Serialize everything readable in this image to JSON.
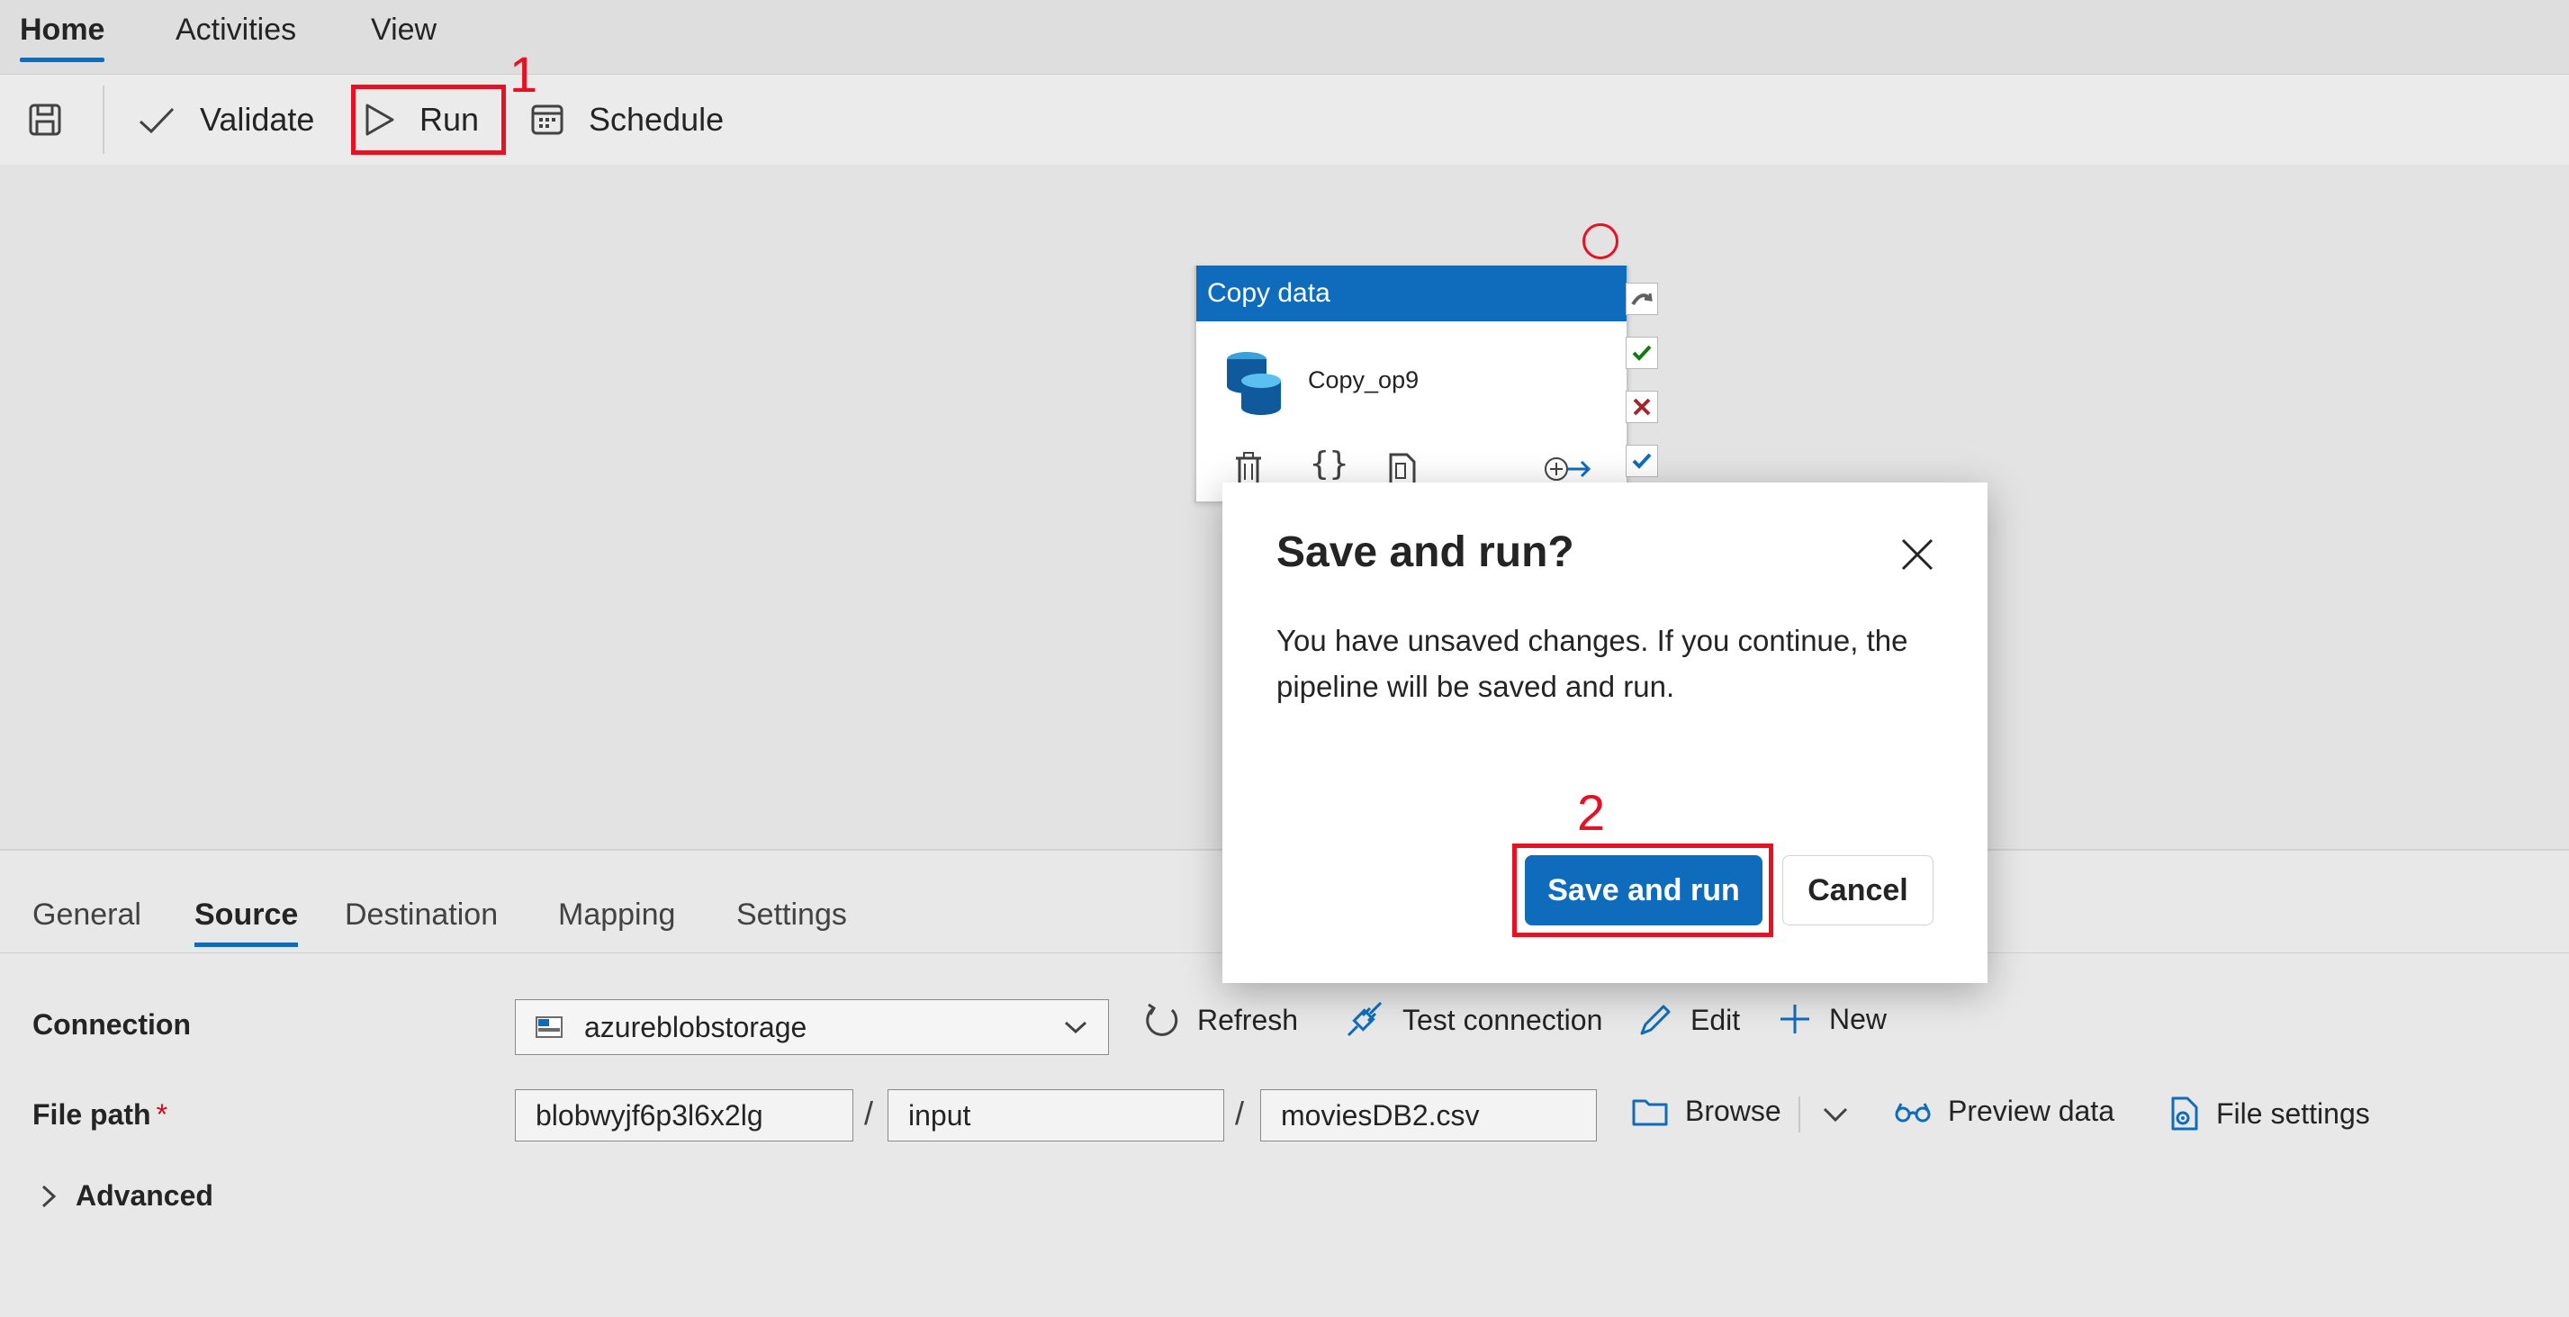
{
  "top_tabs": {
    "home": "Home",
    "activities": "Activities",
    "view": "View"
  },
  "toolbar": {
    "validate": "Validate",
    "run": "Run",
    "schedule": "Schedule"
  },
  "activity": {
    "type": "Copy data",
    "name": "Copy_op9"
  },
  "panel_tabs": {
    "general": "General",
    "source": "Source",
    "destination": "Destination",
    "mapping": "Mapping",
    "settings": "Settings"
  },
  "source": {
    "connection_label": "Connection",
    "connection_value": "azureblobstorage",
    "refresh": "Refresh",
    "test_connection": "Test connection",
    "edit": "Edit",
    "new": "New",
    "file_path_label": "File path",
    "required_marker": "*",
    "path_container": "blobwyjf6p3l6x2lg",
    "path_directory": "input",
    "path_file": "moviesDB2.csv",
    "slash": "/",
    "browse": "Browse",
    "preview_data": "Preview data",
    "file_settings": "File settings",
    "advanced": "Advanced"
  },
  "dialog": {
    "title": "Save and run?",
    "body": "You have unsaved changes. If you continue, the pipeline will be saved and run.",
    "primary": "Save and run",
    "secondary": "Cancel"
  },
  "annotations": {
    "step1": "1",
    "step2": "2"
  },
  "colors": {
    "accent": "#0f6cbd",
    "annotation": "#e81123"
  }
}
